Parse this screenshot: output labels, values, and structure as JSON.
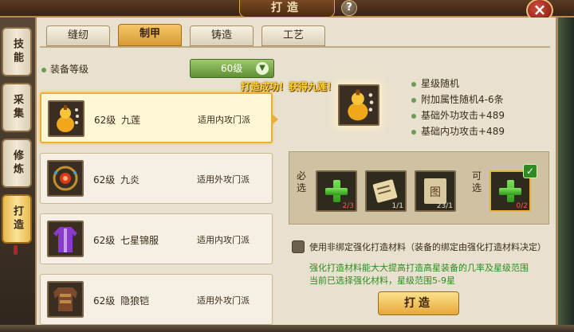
{
  "window": {
    "title": "打造",
    "help": "?",
    "close": "×"
  },
  "side_tabs": [
    {
      "label": "技能"
    },
    {
      "label": "采集"
    },
    {
      "label": "修炼"
    },
    {
      "label": "打造"
    }
  ],
  "tabs": [
    {
      "label": "缝纫"
    },
    {
      "label": "制甲"
    },
    {
      "label": "铸造"
    },
    {
      "label": "工艺"
    }
  ],
  "equip_level": {
    "label": "装备等级",
    "selected": "60级"
  },
  "items": [
    {
      "level": "62级",
      "name": "九莲",
      "school": "适用内攻门派",
      "icon": "gourd-pendant-icon"
    },
    {
      "level": "62级",
      "name": "九炎",
      "school": "适用外攻门派",
      "icon": "gem-necklace-icon"
    },
    {
      "level": "62级",
      "name": "七星锦服",
      "school": "适用内攻门派",
      "icon": "purple-robe-icon"
    },
    {
      "level": "62级",
      "name": "隐狼铠",
      "school": "适用外攻门派",
      "icon": "brown-armor-icon"
    }
  ],
  "success_msg": "打造成功！获得九莲！",
  "result_icon": "gourd-pendant-icon",
  "attributes": [
    "星级随机",
    "附加属性随机4-6条",
    "基础外功攻击+489",
    "基础内功攻击+489"
  ],
  "materials": {
    "required_label": "必选",
    "optional_label": "可选",
    "slots": [
      {
        "icon": "plus-icon",
        "count": "2/3"
      },
      {
        "icon": "scroll-icon",
        "count": "1/1"
      },
      {
        "icon": "pattern-paper-icon",
        "count": "23/1"
      }
    ],
    "optional_slot": {
      "icon": "plus-icon",
      "count": "0/2"
    }
  },
  "use_unbound": "使用非绑定强化打造材料（装备的绑定由强化打造材料决定）",
  "hint_line1": "强化打造材料能大大提高打造高星装备的几率及星级范围",
  "hint_line2": "当前已选择强化材料，星级范围5-9星",
  "forge_button": "打造",
  "colors": {
    "accent_gold": "#e8b03a",
    "green_text": "#2f8a22",
    "success_yellow": "#ffd838"
  }
}
